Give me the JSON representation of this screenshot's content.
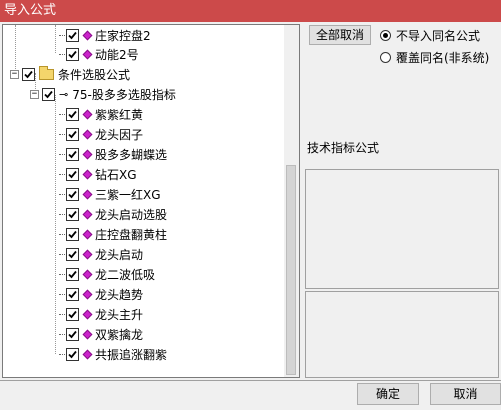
{
  "window": {
    "title": "导入公式"
  },
  "tree": {
    "top_items": [
      {
        "label": "庄家控盘2",
        "checked": true
      },
      {
        "label": "动能2号",
        "checked": true
      }
    ],
    "group": {
      "label": "条件选股公式",
      "checked": true,
      "expand": "−"
    },
    "subgroup": {
      "label": "75-股多多选股指标",
      "checked": true,
      "expand": "−",
      "icon": "key-icon",
      "glyph": "⊸"
    },
    "items": [
      {
        "label": "紫紫红黄",
        "checked": true
      },
      {
        "label": "龙头因子",
        "checked": true
      },
      {
        "label": "股多多蝴蝶选",
        "checked": true
      },
      {
        "label": "钻石XG",
        "checked": true
      },
      {
        "label": "三紫一红XG",
        "checked": true
      },
      {
        "label": "龙头启动选股",
        "checked": true
      },
      {
        "label": "庄控盘翻黄柱",
        "checked": true
      },
      {
        "label": "龙头启动",
        "checked": true
      },
      {
        "label": "龙二波低吸",
        "checked": true
      },
      {
        "label": "龙头趋势",
        "checked": true
      },
      {
        "label": "龙头主升",
        "checked": true
      },
      {
        "label": "双紫擒龙",
        "checked": true
      },
      {
        "label": "共振追涨翻紫",
        "checked": true
      }
    ]
  },
  "options": {
    "cancel_all_label": "全部取消",
    "radio_no_import": "不导入同名公式",
    "radio_overwrite": "覆盖同名(非系统)",
    "selected": "no_import"
  },
  "formula_label": "技术指标公式",
  "buttons": {
    "ok": "确定",
    "cancel": "取消"
  },
  "colors": {
    "title_bar": "#cc4a4a",
    "item_icon": "#cc22cc",
    "folder": "#f4d56b"
  }
}
